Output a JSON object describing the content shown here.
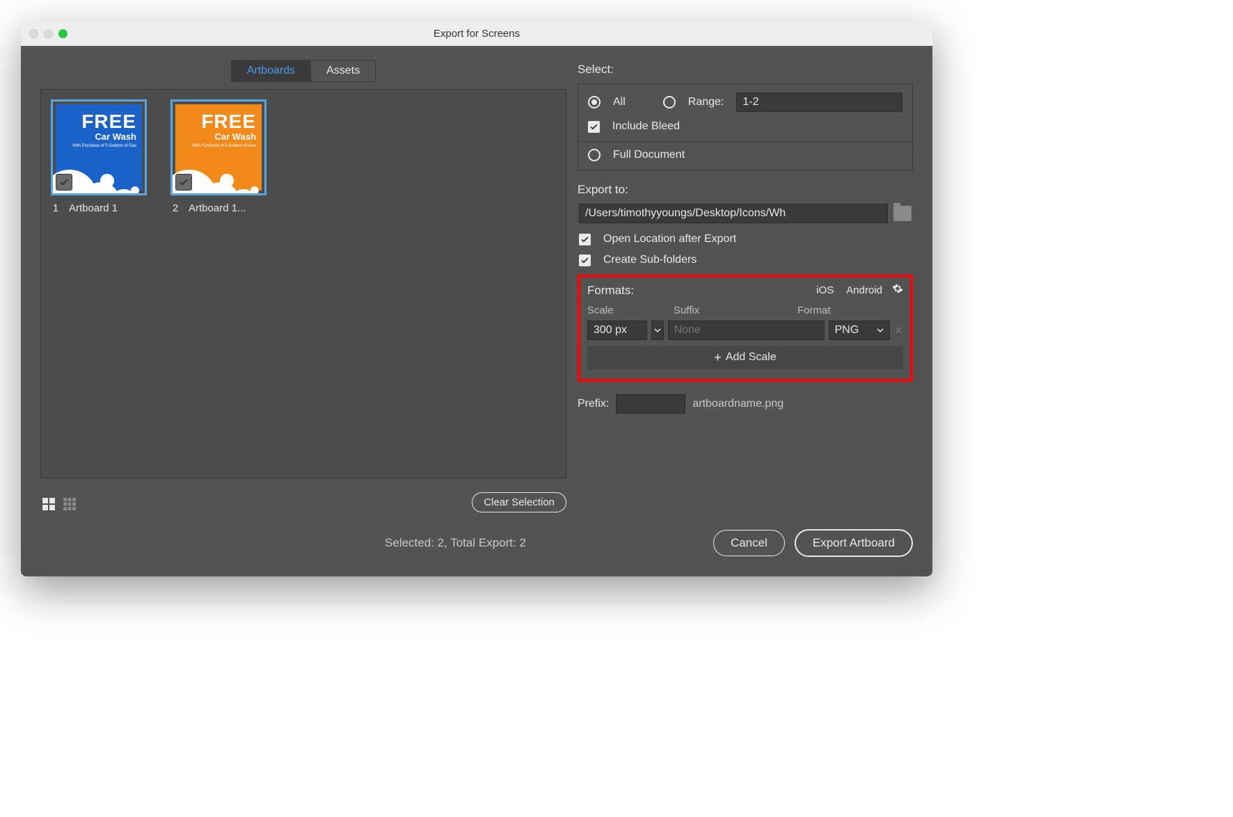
{
  "window": {
    "title": "Export for Screens"
  },
  "tabs": {
    "artboards": "Artboards",
    "assets": "Assets",
    "active": "artboards"
  },
  "thumbnails": [
    {
      "index": "1",
      "label": "Artboard 1",
      "color": "blue",
      "title_big": "FREE",
      "title_mid": "Car Wash",
      "title_sm": "With Purchase of\n5 Gallons of Gas",
      "checked": true
    },
    {
      "index": "2",
      "label": "Artboard 1...",
      "color": "orange",
      "title_big": "FREE",
      "title_mid": "Car Wash",
      "title_sm": "With Purchase of\n5 Gallons of Gas",
      "checked": true
    }
  ],
  "clear_selection": "Clear Selection",
  "select": {
    "heading": "Select:",
    "all_label": "All",
    "range_label": "Range:",
    "range_value": "1-2",
    "include_bleed": "Include Bleed",
    "full_document": "Full Document",
    "selected": "all",
    "include_bleed_checked": true
  },
  "export_to": {
    "heading": "Export to:",
    "path": "/Users/timothyyoungs/Desktop/Icons/Wh",
    "open_location": "Open Location after Export",
    "open_location_checked": true,
    "create_subfolders": "Create Sub-folders",
    "create_subfolders_checked": true
  },
  "formats": {
    "heading": "Formats:",
    "ios": "iOS",
    "android": "Android",
    "cols": {
      "scale": "Scale",
      "suffix": "Suffix",
      "format": "Format"
    },
    "rows": [
      {
        "scale": "300 px",
        "suffix_placeholder": "None",
        "format": "PNG"
      }
    ],
    "add_scale": "Add Scale"
  },
  "prefix": {
    "label": "Prefix:",
    "value": "",
    "suffix_display": "artboardname.png"
  },
  "status": "Selected: 2, Total Export: 2",
  "buttons": {
    "cancel": "Cancel",
    "export": "Export Artboard"
  }
}
